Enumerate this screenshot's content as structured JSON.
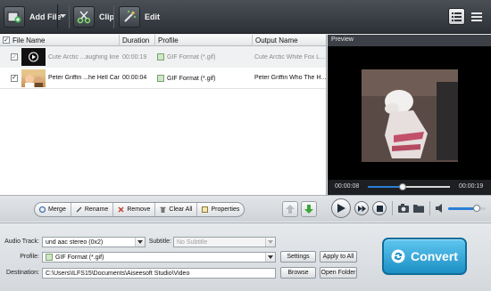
{
  "toolbar": {
    "add_file_label": "Add File",
    "clip_label": "Clip",
    "edit_label": "Edit"
  },
  "list": {
    "columns": [
      "File Name",
      "Duration",
      "Profile",
      "Output Name"
    ],
    "rows": [
      {
        "name": "Cute Arctic ...aughing line",
        "duration": "00:00:19",
        "profile": "GIF Format (*.gif)",
        "output": "Cute Arctic White Fox L..."
      },
      {
        "name": "Peter Griffin ...he Hell Cares",
        "duration": "00:00:04",
        "profile": "GIF Format (*.gif)",
        "output": "Peter Griffin Who The H..."
      }
    ],
    "actions": [
      "Merge",
      "Rename",
      "Remove",
      "Clear All",
      "Properties"
    ]
  },
  "preview": {
    "title": "Preview",
    "current_time": "00:00:08",
    "total_time": "00:00:19",
    "progress": 0.42,
    "volume": 0.75
  },
  "settings": {
    "audio_track_label": "Audio Track:",
    "audio_track_value": "und aac stereo (0x2)",
    "subtitle_label": "Subtitle:",
    "subtitle_value": "No Subtitle",
    "profile_label": "Profile:",
    "profile_value": "GIF Format (*.gif)",
    "settings_btn": "Settings",
    "apply_all_btn": "Apply to All",
    "destination_label": "Destination:",
    "destination_value": "C:\\Users\\ILFS15\\Documents\\Aiseesoft Studio\\Video",
    "browse_btn": "Browse",
    "open_folder_btn": "Open Folder",
    "convert_label": "Convert"
  },
  "colors": {
    "accent": "#1c8fc4",
    "toolbar_bg": "#2d3137",
    "progress_blue": "#2a7fd6"
  }
}
